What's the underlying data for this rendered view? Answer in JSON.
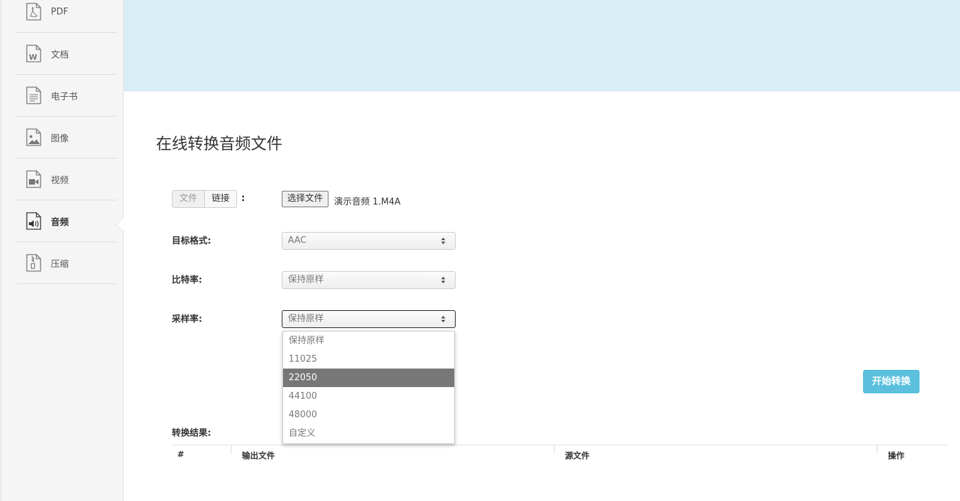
{
  "sidebar": {
    "items": [
      {
        "label": "PDF",
        "icon": "pdf-file-icon"
      },
      {
        "label": "文档",
        "icon": "word-file-icon"
      },
      {
        "label": "电子书",
        "icon": "ebook-file-icon"
      },
      {
        "label": "图像",
        "icon": "image-file-icon"
      },
      {
        "label": "视频",
        "icon": "video-file-icon"
      },
      {
        "label": "音频",
        "icon": "audio-file-icon",
        "active": true
      },
      {
        "label": "压缩",
        "icon": "archive-file-icon"
      }
    ]
  },
  "page": {
    "title": "在线转换音频文件"
  },
  "source": {
    "tabs": [
      "文件",
      "链接"
    ],
    "colon": ":",
    "choose_button": "选择文件",
    "file_name": "演示音频 1.M4A"
  },
  "form": {
    "target_format": {
      "label": "目标格式:",
      "value": "AAC"
    },
    "bitrate": {
      "label": "比特率:",
      "value": "保持原样"
    },
    "sample_rate": {
      "label": "采样率:",
      "value": "保持原样"
    }
  },
  "dropdown": {
    "options": [
      "保持原样",
      "11025",
      "22050",
      "44100",
      "48000",
      "自定义"
    ],
    "highlighted": "22050"
  },
  "actions": {
    "start_label": "开始转换"
  },
  "results": {
    "label": "转换结果:",
    "columns": [
      "#",
      "输出文件",
      "源文件",
      "操作"
    ]
  },
  "colors": {
    "accent": "#5bc0de",
    "banner": "#d9edf6"
  }
}
